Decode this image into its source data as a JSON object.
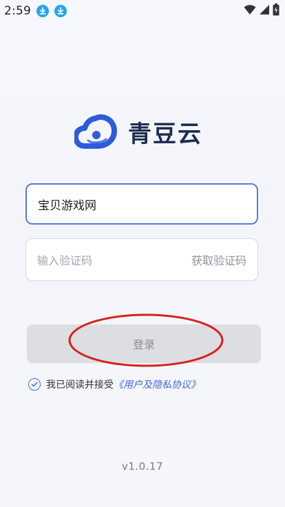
{
  "status_bar": {
    "time": "2:59",
    "left_icons": [
      "download-icon",
      "download-icon"
    ],
    "right_icons": [
      "wifi-icon",
      "cellular-signal-icon",
      "battery-charging-icon"
    ]
  },
  "logo": {
    "icon": "cloud-logo-icon",
    "brand_name": "青豆云"
  },
  "form": {
    "account_value": "宝贝游戏网",
    "code_placeholder": "输入验证码",
    "get_code_label": "获取验证码",
    "login_label": "登录"
  },
  "agreement": {
    "checked": true,
    "text": "我已阅读并接受",
    "link_text": "《用户及隐私协议》"
  },
  "version": "v1.0.17",
  "colors": {
    "accent": "#5a79e3",
    "link": "#3f69db",
    "annotation": "#d6231d",
    "button_disabled": "#dcdee2"
  }
}
